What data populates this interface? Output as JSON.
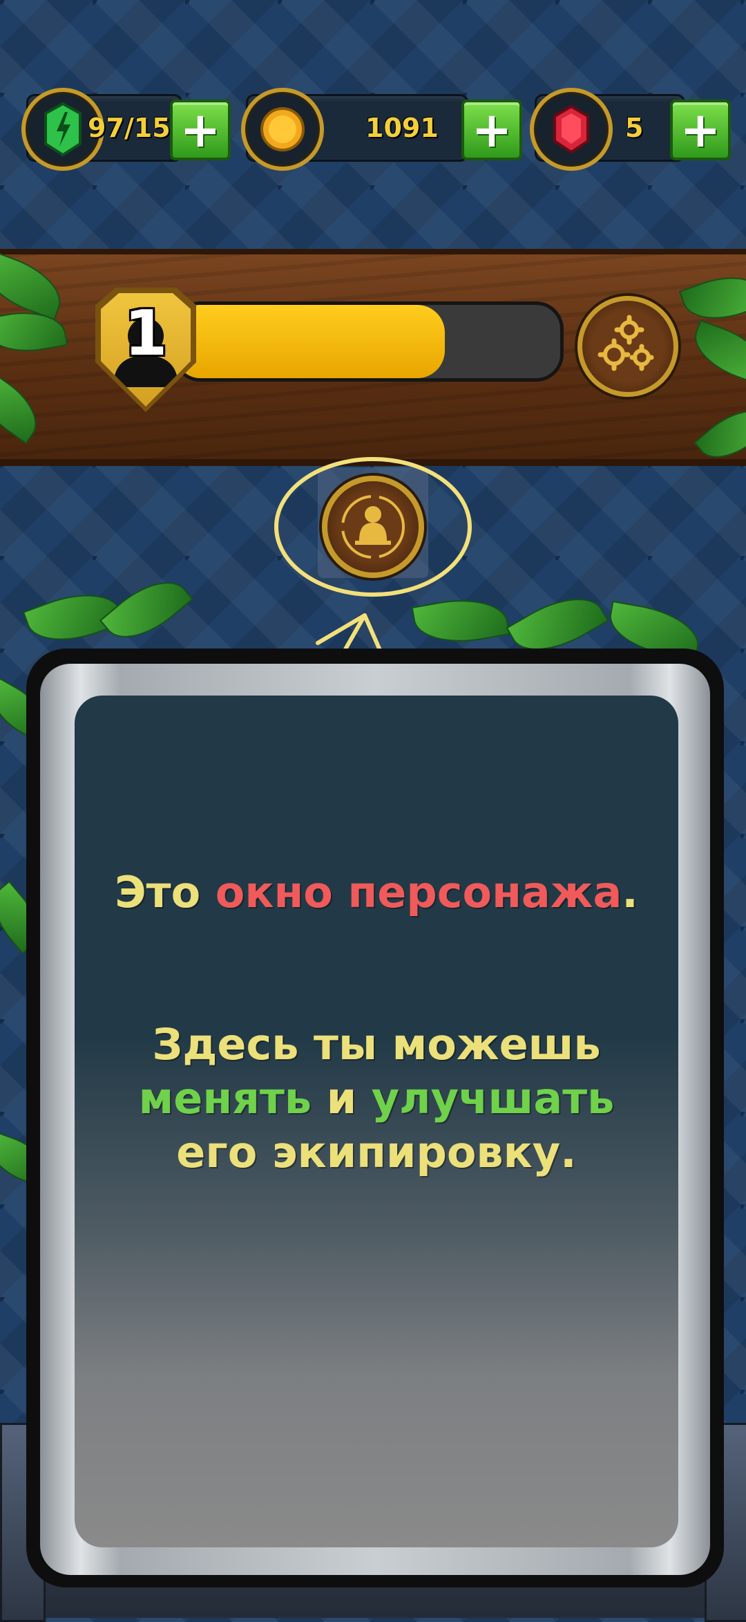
{
  "resources": {
    "energy": {
      "icon": "energy-gem-icon",
      "value": "97/15",
      "color": "#2ec24a"
    },
    "coins": {
      "icon": "coin-icon",
      "value": "1091",
      "color": "#f2a81c"
    },
    "rubies": {
      "icon": "ruby-icon",
      "value": "5",
      "color": "#d8253a"
    },
    "add_label": "+"
  },
  "level": {
    "number": "1",
    "xp_progress_fraction": 0.7,
    "badge_icon": "player-silhouette-icon",
    "settings_icon": "gears-icon"
  },
  "character_button": {
    "icon": "character-equipment-icon"
  },
  "tutorial": {
    "line1_prefix": "Это ",
    "line1_highlight": "окно персонажа",
    "line1_suffix": ".",
    "line2": "Здесь ты можешь",
    "line3_word1": "менять",
    "line3_and": " и ",
    "line3_word2": "улучшать",
    "line4": "его экипировку."
  },
  "colors": {
    "accent_gold": "#c59a2a",
    "xp_fill": "#f5b700",
    "text_cream": "#ece07a",
    "text_red": "#f05a5a",
    "text_green": "#6fd24a",
    "annotation_yellow": "#f3e07a"
  }
}
